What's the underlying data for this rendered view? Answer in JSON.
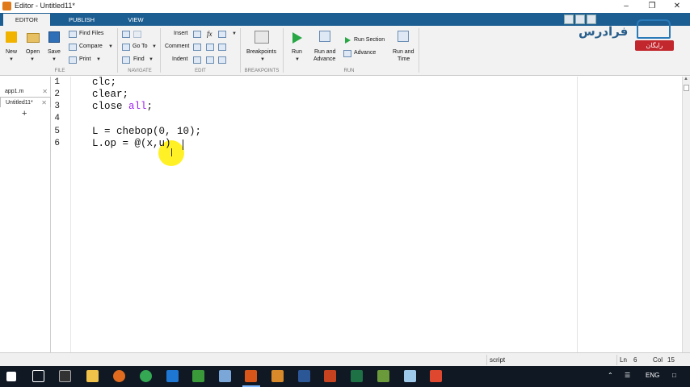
{
  "window": {
    "title": "Editor - Untitled11*"
  },
  "ribbon_tabs": [
    "EDITOR",
    "PUBLISH",
    "VIEW"
  ],
  "ribbon": {
    "file": {
      "new": "New",
      "open": "Open",
      "save": "Save",
      "find_files": "Find Files",
      "compare": "Compare",
      "print": "Print",
      "group": "FILE"
    },
    "navigate": {
      "go_to": "Go To",
      "find": "Find",
      "group": "NAVIGATE"
    },
    "edit": {
      "insert": "Insert",
      "fx": "fx",
      "comment": "Comment",
      "indent": "Indent",
      "group": "EDIT"
    },
    "breakpoints": {
      "label": "Breakpoints",
      "group": "BREAKPOINTS"
    },
    "run": {
      "run": "Run",
      "run_and_advance_1": "Run and",
      "run_and_advance_2": "Advance",
      "run_section": "Run Section",
      "advance": "Advance",
      "run_and_time_1": "Run and",
      "run_and_time_2": "Time",
      "group": "RUN"
    }
  },
  "logo": {
    "brand": "فرادرس",
    "badge": "رایگان"
  },
  "file_tabs": [
    {
      "name": "app1.m"
    },
    {
      "name": "Untitled11*"
    }
  ],
  "add_tab": "+",
  "code": {
    "line_numbers": [
      "1",
      "2",
      "3",
      "4",
      "5",
      "6"
    ],
    "lines": {
      "l1": "clc;",
      "l2": "clear;",
      "l3a": "close ",
      "l3b": "all",
      "l3c": ";",
      "l4": "",
      "l5": "L = chebop(0, 10);",
      "l6": "L.op = @(x,u) "
    }
  },
  "status": {
    "mode": "script",
    "ln_label": "Ln",
    "ln": "6",
    "col_label": "Col",
    "col": "15"
  },
  "taskbar": {
    "lang": "ENG"
  },
  "colors": {
    "ribbon_tab_bar": "#1d5e92",
    "keyword": "#a020f0",
    "highlight": "#ffee00"
  }
}
